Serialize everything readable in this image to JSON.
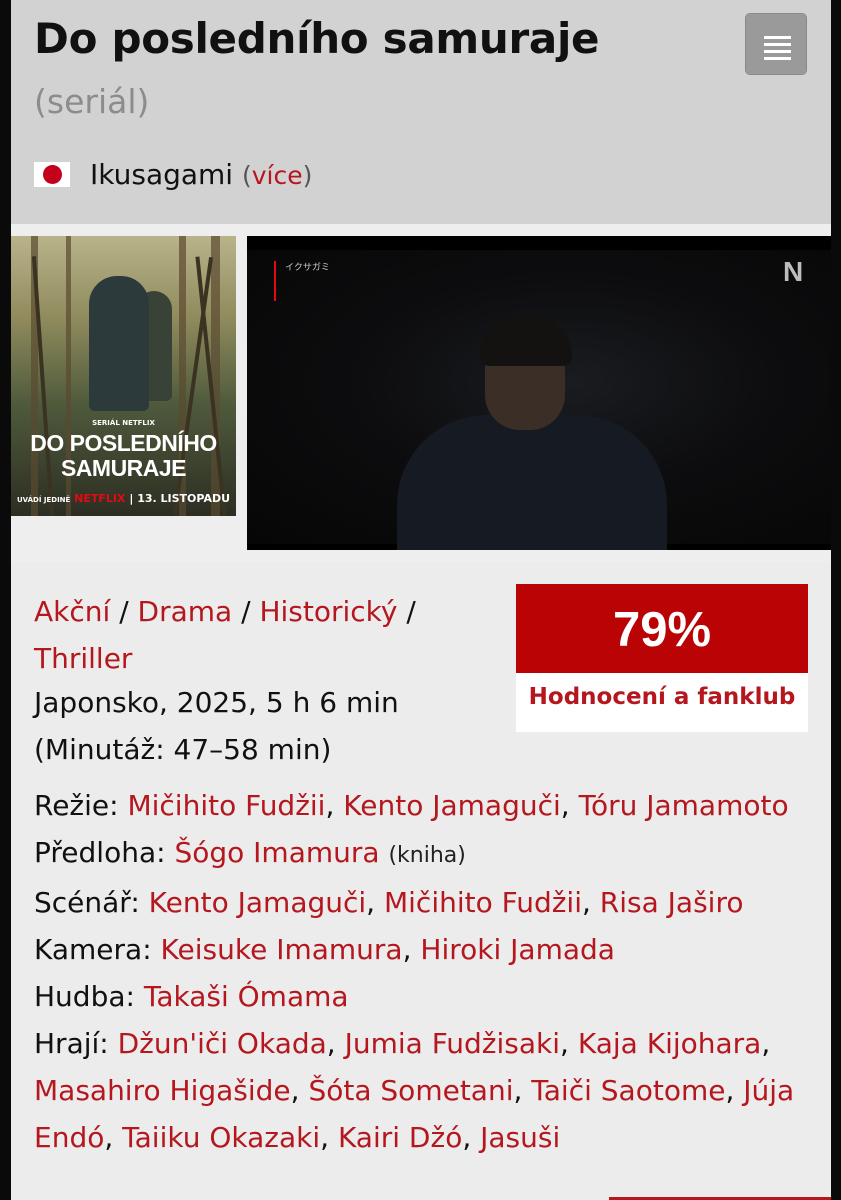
{
  "header": {
    "title": "Do posledního samuraje",
    "subtitle": "(seriál)",
    "original_title": "Ikusagami",
    "more_open": "(",
    "more_link": "více",
    "more_close": ")",
    "flag_icon": "japan-flag-icon",
    "menu_icon": "hamburger-menu-icon"
  },
  "poster": {
    "series_label": "SERIÁL NETFLIX",
    "title_line1": "DO POSLEDNÍHO",
    "title_line2": "SAMURAJE",
    "brand_prefix": "UVÁDÍ JEDINĚ",
    "brand_netflix": "NETFLIX",
    "brand_date": "| 13. LISTOPADU"
  },
  "video": {
    "caption": "イクサガミ",
    "logo": "N"
  },
  "genres": [
    "Akční",
    "Drama",
    "Historický",
    "Thriller"
  ],
  "genre_sep": " / ",
  "meta": {
    "line1": "Japonsko, 2025, 5 h 6 min",
    "line2": "(Minutáž: 47–58 min)"
  },
  "rating": {
    "percent": "79%",
    "label": "Hodnocení a fanklub",
    "color": "#ba0305"
  },
  "crew": {
    "directors_label": "Režie:",
    "directors": [
      "Mičihito Fudžii",
      "Kento Jamaguči",
      "Tóru Jamamoto"
    ],
    "source_label": "Předloha:",
    "source_author": "Šógo Imamura",
    "source_note": "(kniha)",
    "writers_label": "Scénář:",
    "writers": [
      "Kento Jamaguči",
      "Mičihito Fudžii",
      "Risa Jaširo"
    ],
    "camera_label": "Kamera:",
    "camera": [
      "Keisuke Imamura",
      "Hiroki Jamada"
    ],
    "music_label": "Hudba:",
    "music": [
      "Takaši Ómama"
    ],
    "cast_label": "Hrají:",
    "cast": [
      "Džun'iči Okada",
      "Jumia Fudžisaki",
      "Kaja Kijohara",
      "Masahiro Higašide",
      "Šóta Sometani",
      "Taiči Saotome",
      "Júja Endó",
      "Taiiku Okazaki",
      "Kairi Džó",
      "Jasuši"
    ]
  },
  "colors": {
    "link": "#b5171e",
    "header_bg": "#d2d2d2",
    "content_bg": "#ececec"
  }
}
